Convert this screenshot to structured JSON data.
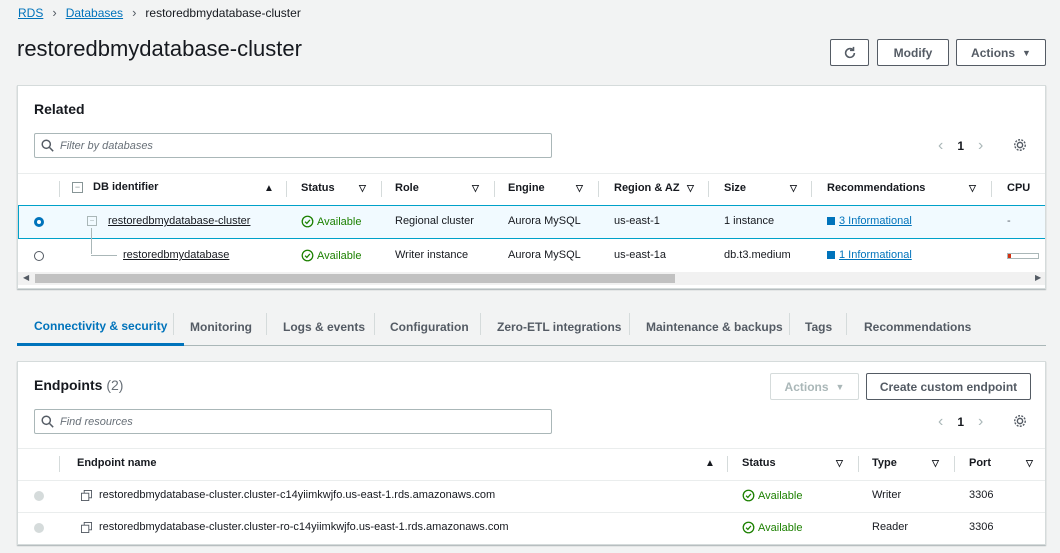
{
  "breadcrumb": {
    "items": [
      "RDS",
      "Databases"
    ],
    "current": "restoredbmydatabase-cluster"
  },
  "page": {
    "title": "restoredbmydatabase-cluster"
  },
  "header_actions": {
    "modify": "Modify",
    "actions": "Actions"
  },
  "related": {
    "title": "Related",
    "filter_placeholder": "Filter by databases",
    "page": "1",
    "columns": [
      "DB identifier",
      "Status",
      "Role",
      "Engine",
      "Region & AZ",
      "Size",
      "Recommendations",
      "CPU"
    ],
    "rows": [
      {
        "id": "restoredbmydatabase-cluster",
        "status": "Available",
        "role": "Regional cluster",
        "engine": "Aurora MySQL",
        "region": "us-east-1",
        "size": "1 instance",
        "recommendations": "3 Informational",
        "cpu": "-",
        "selected": true
      },
      {
        "id": "restoredbmydatabase",
        "status": "Available",
        "role": "Writer instance",
        "engine": "Aurora MySQL",
        "region": "us-east-1a",
        "size": "db.t3.medium",
        "recommendations": "1 Informational",
        "cpu": "",
        "selected": false
      }
    ]
  },
  "tabs": [
    "Connectivity & security",
    "Monitoring",
    "Logs & events",
    "Configuration",
    "Zero-ETL integrations",
    "Maintenance & backups",
    "Tags",
    "Recommendations"
  ],
  "endpoints": {
    "title": "Endpoints",
    "count": "(2)",
    "actions_label": "Actions",
    "create_label": "Create custom endpoint",
    "search_placeholder": "Find resources",
    "page": "1",
    "columns": [
      "Endpoint name",
      "Status",
      "Type",
      "Port"
    ],
    "rows": [
      {
        "name": "restoredbmydatabase-cluster.cluster-c14yiimkwjfo.us-east-1.rds.amazonaws.com",
        "status": "Available",
        "type": "Writer",
        "port": "3306"
      },
      {
        "name": "restoredbmydatabase-cluster.cluster-ro-c14yiimkwjfo.us-east-1.rds.amazonaws.com",
        "status": "Available",
        "type": "Reader",
        "port": "3306"
      }
    ]
  },
  "colors": {
    "accent": "#0073bb",
    "success": "#1d8102",
    "border": "#d5dbdb"
  }
}
